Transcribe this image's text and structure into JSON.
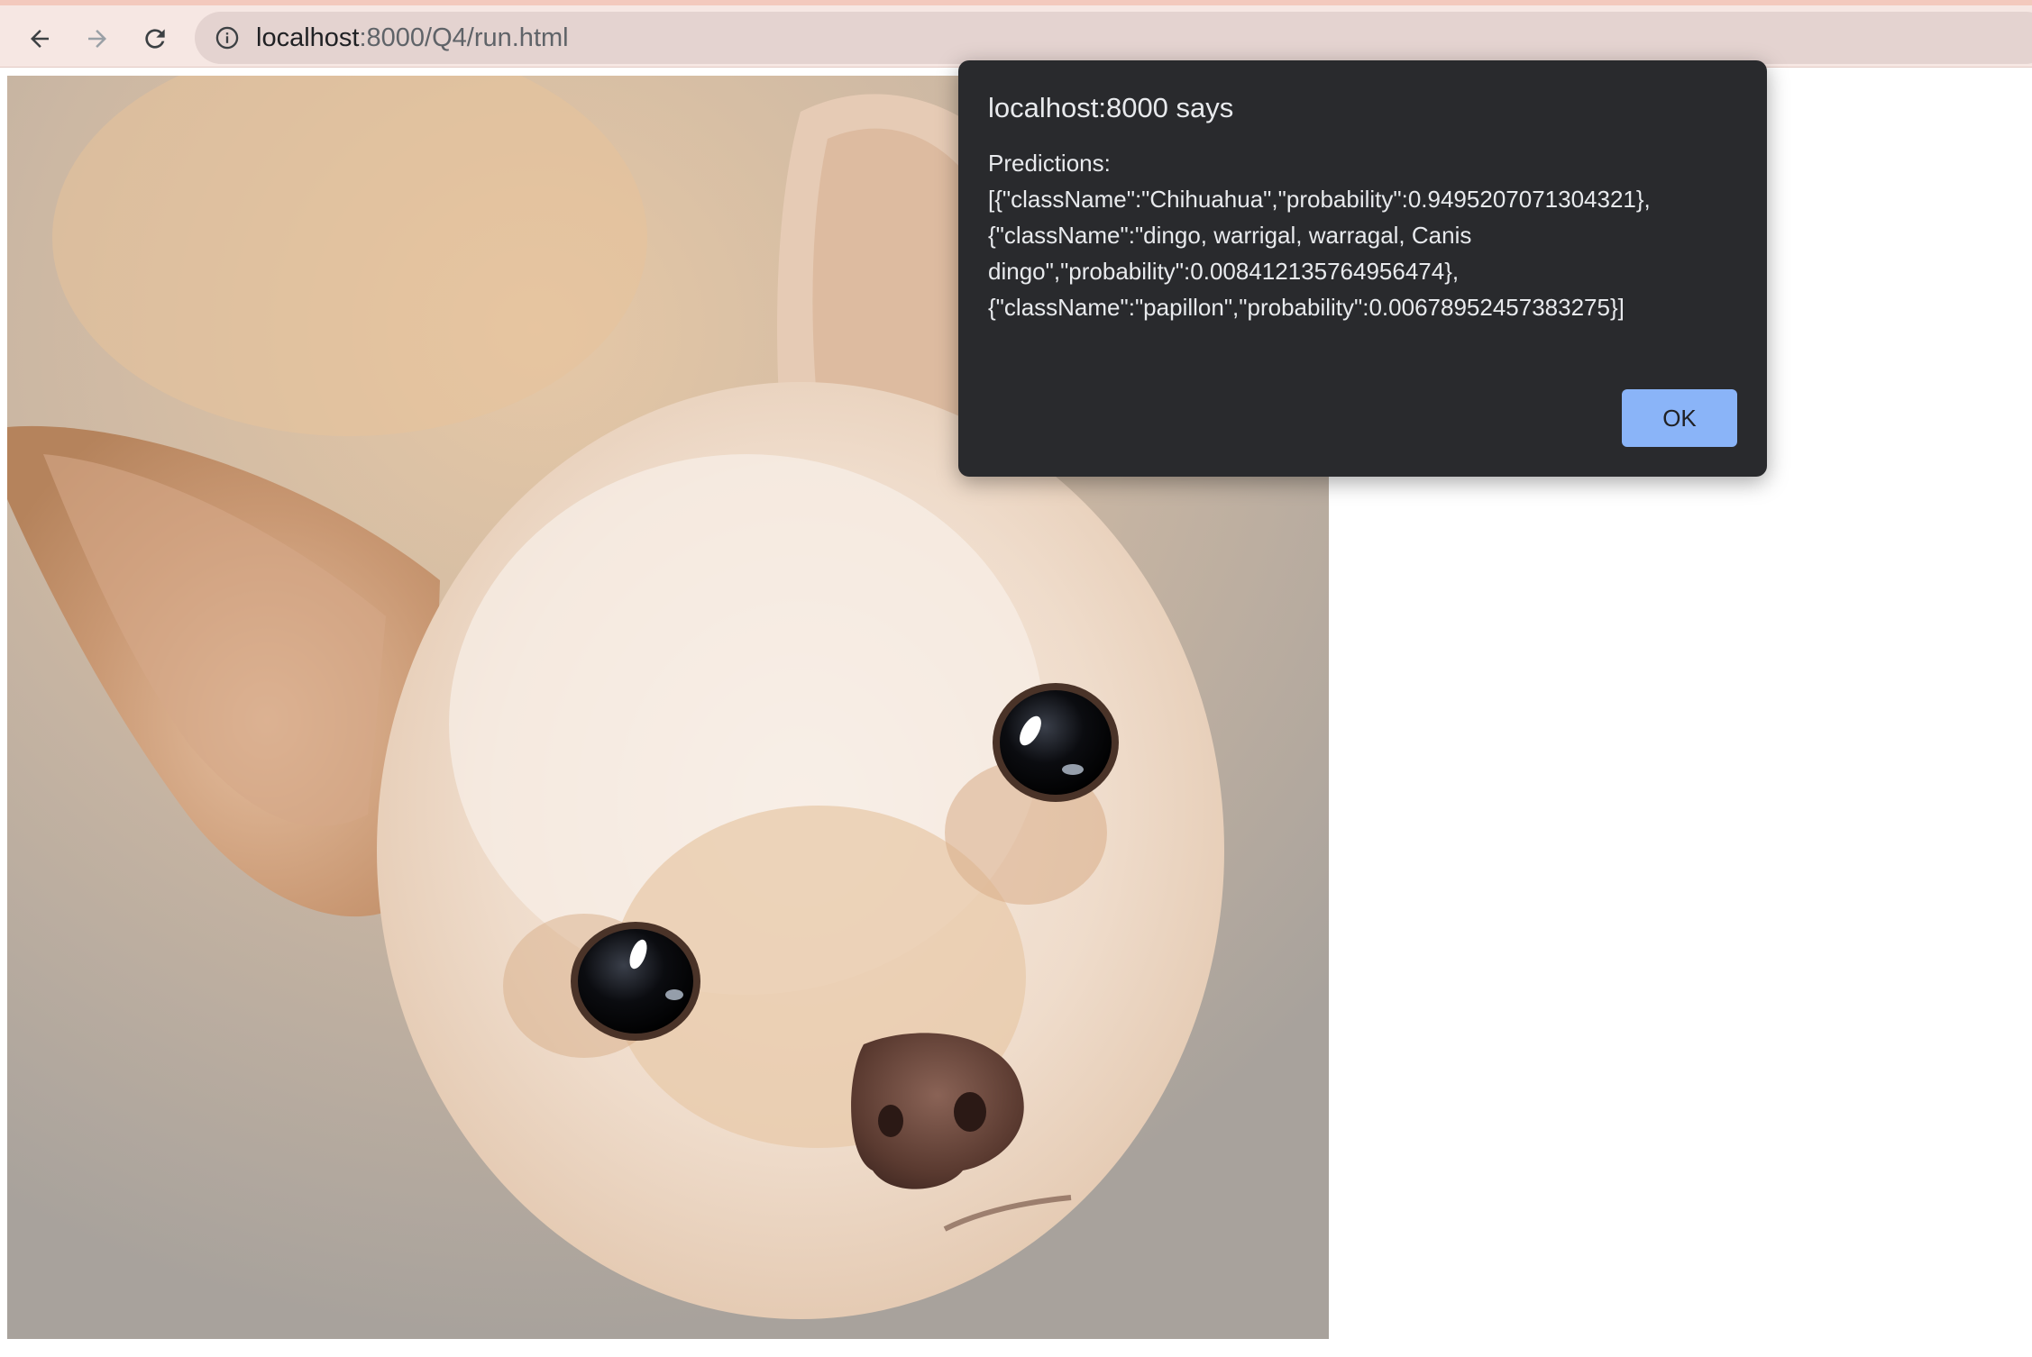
{
  "browser": {
    "url_host": "localhost",
    "url_path": ":8000/Q4/run.html",
    "icons": {
      "back": "back-arrow-icon",
      "forward": "forward-arrow-icon",
      "reload": "reload-icon",
      "site_info": "info-icon"
    }
  },
  "page": {
    "image_subject": "dog-photo"
  },
  "dialog": {
    "title": "localhost:8000 says",
    "message": "Predictions:\n[{\"className\":\"Chihuahua\",\"probability\":0.9495207071304321},\n{\"className\":\"dingo, warrigal, warragal, Canis\ndingo\",\"probability\":0.008412135764956474},\n{\"className\":\"papillon\",\"probability\":0.006789524573832​75}]",
    "ok_label": "OK"
  },
  "colors": {
    "toolbar_bg": "#f6e7e3",
    "omnibox_bg": "#e4d3d0",
    "dialog_bg": "#292a2d",
    "ok_button": "#8ab4f8"
  }
}
